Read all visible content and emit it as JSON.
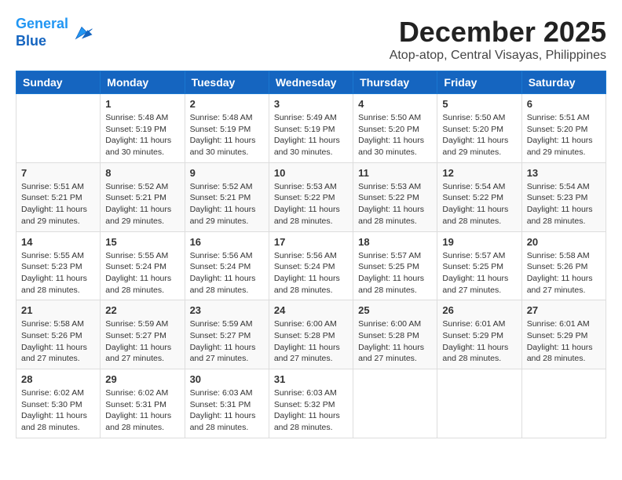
{
  "logo": {
    "line1": "General",
    "line2": "Blue"
  },
  "title": "December 2025",
  "location": "Atop-atop, Central Visayas, Philippines",
  "days_of_week": [
    "Sunday",
    "Monday",
    "Tuesday",
    "Wednesday",
    "Thursday",
    "Friday",
    "Saturday"
  ],
  "weeks": [
    [
      {
        "day": "",
        "info": ""
      },
      {
        "day": "1",
        "info": "Sunrise: 5:48 AM\nSunset: 5:19 PM\nDaylight: 11 hours\nand 30 minutes."
      },
      {
        "day": "2",
        "info": "Sunrise: 5:48 AM\nSunset: 5:19 PM\nDaylight: 11 hours\nand 30 minutes."
      },
      {
        "day": "3",
        "info": "Sunrise: 5:49 AM\nSunset: 5:19 PM\nDaylight: 11 hours\nand 30 minutes."
      },
      {
        "day": "4",
        "info": "Sunrise: 5:50 AM\nSunset: 5:20 PM\nDaylight: 11 hours\nand 30 minutes."
      },
      {
        "day": "5",
        "info": "Sunrise: 5:50 AM\nSunset: 5:20 PM\nDaylight: 11 hours\nand 29 minutes."
      },
      {
        "day": "6",
        "info": "Sunrise: 5:51 AM\nSunset: 5:20 PM\nDaylight: 11 hours\nand 29 minutes."
      }
    ],
    [
      {
        "day": "7",
        "info": "Sunrise: 5:51 AM\nSunset: 5:21 PM\nDaylight: 11 hours\nand 29 minutes."
      },
      {
        "day": "8",
        "info": "Sunrise: 5:52 AM\nSunset: 5:21 PM\nDaylight: 11 hours\nand 29 minutes."
      },
      {
        "day": "9",
        "info": "Sunrise: 5:52 AM\nSunset: 5:21 PM\nDaylight: 11 hours\nand 29 minutes."
      },
      {
        "day": "10",
        "info": "Sunrise: 5:53 AM\nSunset: 5:22 PM\nDaylight: 11 hours\nand 28 minutes."
      },
      {
        "day": "11",
        "info": "Sunrise: 5:53 AM\nSunset: 5:22 PM\nDaylight: 11 hours\nand 28 minutes."
      },
      {
        "day": "12",
        "info": "Sunrise: 5:54 AM\nSunset: 5:22 PM\nDaylight: 11 hours\nand 28 minutes."
      },
      {
        "day": "13",
        "info": "Sunrise: 5:54 AM\nSunset: 5:23 PM\nDaylight: 11 hours\nand 28 minutes."
      }
    ],
    [
      {
        "day": "14",
        "info": "Sunrise: 5:55 AM\nSunset: 5:23 PM\nDaylight: 11 hours\nand 28 minutes."
      },
      {
        "day": "15",
        "info": "Sunrise: 5:55 AM\nSunset: 5:24 PM\nDaylight: 11 hours\nand 28 minutes."
      },
      {
        "day": "16",
        "info": "Sunrise: 5:56 AM\nSunset: 5:24 PM\nDaylight: 11 hours\nand 28 minutes."
      },
      {
        "day": "17",
        "info": "Sunrise: 5:56 AM\nSunset: 5:24 PM\nDaylight: 11 hours\nand 28 minutes."
      },
      {
        "day": "18",
        "info": "Sunrise: 5:57 AM\nSunset: 5:25 PM\nDaylight: 11 hours\nand 28 minutes."
      },
      {
        "day": "19",
        "info": "Sunrise: 5:57 AM\nSunset: 5:25 PM\nDaylight: 11 hours\nand 27 minutes."
      },
      {
        "day": "20",
        "info": "Sunrise: 5:58 AM\nSunset: 5:26 PM\nDaylight: 11 hours\nand 27 minutes."
      }
    ],
    [
      {
        "day": "21",
        "info": "Sunrise: 5:58 AM\nSunset: 5:26 PM\nDaylight: 11 hours\nand 27 minutes."
      },
      {
        "day": "22",
        "info": "Sunrise: 5:59 AM\nSunset: 5:27 PM\nDaylight: 11 hours\nand 27 minutes."
      },
      {
        "day": "23",
        "info": "Sunrise: 5:59 AM\nSunset: 5:27 PM\nDaylight: 11 hours\nand 27 minutes."
      },
      {
        "day": "24",
        "info": "Sunrise: 6:00 AM\nSunset: 5:28 PM\nDaylight: 11 hours\nand 27 minutes."
      },
      {
        "day": "25",
        "info": "Sunrise: 6:00 AM\nSunset: 5:28 PM\nDaylight: 11 hours\nand 27 minutes."
      },
      {
        "day": "26",
        "info": "Sunrise: 6:01 AM\nSunset: 5:29 PM\nDaylight: 11 hours\nand 28 minutes."
      },
      {
        "day": "27",
        "info": "Sunrise: 6:01 AM\nSunset: 5:29 PM\nDaylight: 11 hours\nand 28 minutes."
      }
    ],
    [
      {
        "day": "28",
        "info": "Sunrise: 6:02 AM\nSunset: 5:30 PM\nDaylight: 11 hours\nand 28 minutes."
      },
      {
        "day": "29",
        "info": "Sunrise: 6:02 AM\nSunset: 5:31 PM\nDaylight: 11 hours\nand 28 minutes."
      },
      {
        "day": "30",
        "info": "Sunrise: 6:03 AM\nSunset: 5:31 PM\nDaylight: 11 hours\nand 28 minutes."
      },
      {
        "day": "31",
        "info": "Sunrise: 6:03 AM\nSunset: 5:32 PM\nDaylight: 11 hours\nand 28 minutes."
      },
      {
        "day": "",
        "info": ""
      },
      {
        "day": "",
        "info": ""
      },
      {
        "day": "",
        "info": ""
      }
    ]
  ]
}
